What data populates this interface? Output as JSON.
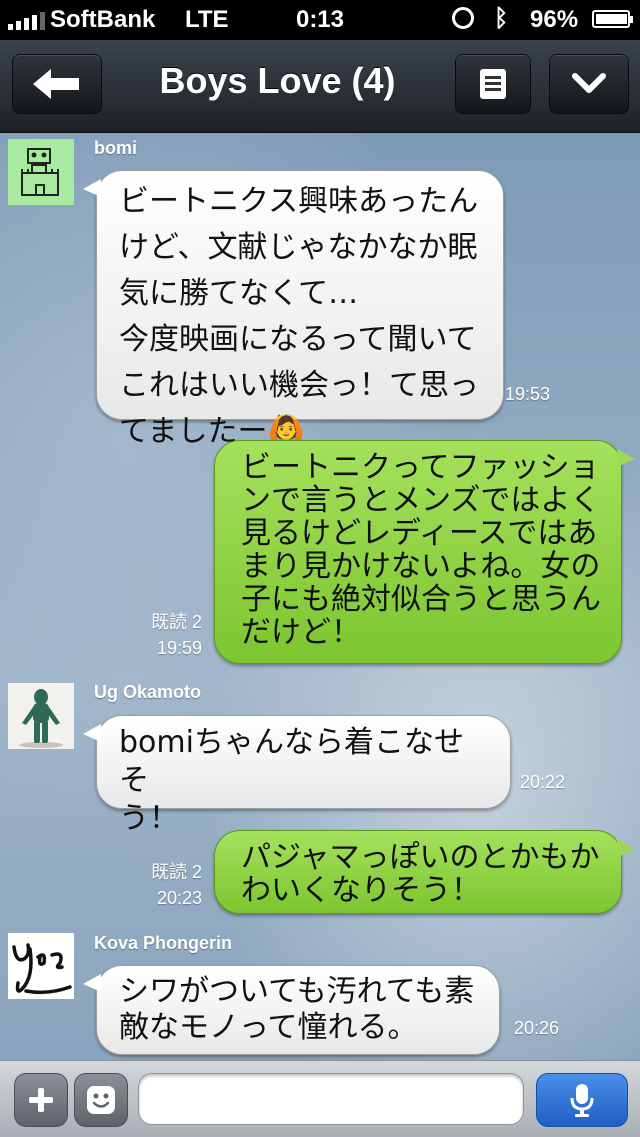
{
  "status_bar": {
    "carrier": "SoftBank",
    "network": "LTE",
    "time": "0:13",
    "battery_percent": "96%"
  },
  "nav": {
    "title": "Boys Love (4)"
  },
  "messages": [
    {
      "sender": "bomi",
      "text": "ビートニクス興味あったん\nけど、文献じゃなかなか眠\n気に勝てなくて…\n今度映画になるって聞いて\nこれはいい機会っ！て思っ\nてましたー🙆",
      "time": "19:53"
    },
    {
      "text": "ビートニクってファッショ\nンで言うとメンズではよく\n見るけどレディースではあ\nまり見かけないよね。女の\n子にも絶対似合うと思うん\nだけど！",
      "read": "既読 2",
      "time": "19:59"
    },
    {
      "sender": "Ug Okamoto",
      "text": "bomiちゃんなら着こなせそ\nう！",
      "time": "20:22"
    },
    {
      "text": "パジャマっぽいのとかもか\nわいくなりそう！",
      "read": "既読 2",
      "time": "20:23"
    },
    {
      "sender": "Kova Phongerin",
      "text": "シワがついても汚れても素\n敵なモノって憧れる。",
      "time": "20:26"
    }
  ],
  "input": {
    "placeholder": ""
  },
  "colors": {
    "outgoing_bubble": "#8fd044",
    "incoming_bubble": "#ffffff",
    "nav_bar": "#2b3137",
    "send_button": "#2f74d6"
  },
  "icons": {
    "back": "arrow-left-icon",
    "menu": "list-icon",
    "dropdown": "chevron-down-icon",
    "add": "plus-icon",
    "emoji": "smiley-icon",
    "voice": "microphone-icon"
  }
}
